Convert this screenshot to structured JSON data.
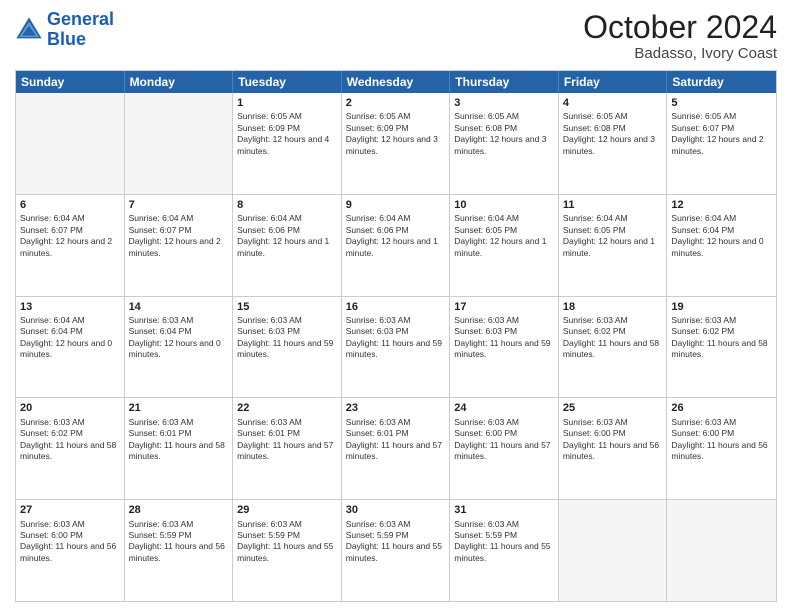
{
  "logo": {
    "line1": "General",
    "line2": "Blue"
  },
  "title": "October 2024",
  "location": "Badasso, Ivory Coast",
  "weekdays": [
    "Sunday",
    "Monday",
    "Tuesday",
    "Wednesday",
    "Thursday",
    "Friday",
    "Saturday"
  ],
  "weeks": [
    [
      {
        "day": "",
        "info": ""
      },
      {
        "day": "",
        "info": ""
      },
      {
        "day": "1",
        "info": "Sunrise: 6:05 AM\nSunset: 6:09 PM\nDaylight: 12 hours and 4 minutes."
      },
      {
        "day": "2",
        "info": "Sunrise: 6:05 AM\nSunset: 6:09 PM\nDaylight: 12 hours and 3 minutes."
      },
      {
        "day": "3",
        "info": "Sunrise: 6:05 AM\nSunset: 6:08 PM\nDaylight: 12 hours and 3 minutes."
      },
      {
        "day": "4",
        "info": "Sunrise: 6:05 AM\nSunset: 6:08 PM\nDaylight: 12 hours and 3 minutes."
      },
      {
        "day": "5",
        "info": "Sunrise: 6:05 AM\nSunset: 6:07 PM\nDaylight: 12 hours and 2 minutes."
      }
    ],
    [
      {
        "day": "6",
        "info": "Sunrise: 6:04 AM\nSunset: 6:07 PM\nDaylight: 12 hours and 2 minutes."
      },
      {
        "day": "7",
        "info": "Sunrise: 6:04 AM\nSunset: 6:07 PM\nDaylight: 12 hours and 2 minutes."
      },
      {
        "day": "8",
        "info": "Sunrise: 6:04 AM\nSunset: 6:06 PM\nDaylight: 12 hours and 1 minute."
      },
      {
        "day": "9",
        "info": "Sunrise: 6:04 AM\nSunset: 6:06 PM\nDaylight: 12 hours and 1 minute."
      },
      {
        "day": "10",
        "info": "Sunrise: 6:04 AM\nSunset: 6:05 PM\nDaylight: 12 hours and 1 minute."
      },
      {
        "day": "11",
        "info": "Sunrise: 6:04 AM\nSunset: 6:05 PM\nDaylight: 12 hours and 1 minute."
      },
      {
        "day": "12",
        "info": "Sunrise: 6:04 AM\nSunset: 6:04 PM\nDaylight: 12 hours and 0 minutes."
      }
    ],
    [
      {
        "day": "13",
        "info": "Sunrise: 6:04 AM\nSunset: 6:04 PM\nDaylight: 12 hours and 0 minutes."
      },
      {
        "day": "14",
        "info": "Sunrise: 6:03 AM\nSunset: 6:04 PM\nDaylight: 12 hours and 0 minutes."
      },
      {
        "day": "15",
        "info": "Sunrise: 6:03 AM\nSunset: 6:03 PM\nDaylight: 11 hours and 59 minutes."
      },
      {
        "day": "16",
        "info": "Sunrise: 6:03 AM\nSunset: 6:03 PM\nDaylight: 11 hours and 59 minutes."
      },
      {
        "day": "17",
        "info": "Sunrise: 6:03 AM\nSunset: 6:03 PM\nDaylight: 11 hours and 59 minutes."
      },
      {
        "day": "18",
        "info": "Sunrise: 6:03 AM\nSunset: 6:02 PM\nDaylight: 11 hours and 58 minutes."
      },
      {
        "day": "19",
        "info": "Sunrise: 6:03 AM\nSunset: 6:02 PM\nDaylight: 11 hours and 58 minutes."
      }
    ],
    [
      {
        "day": "20",
        "info": "Sunrise: 6:03 AM\nSunset: 6:02 PM\nDaylight: 11 hours and 58 minutes."
      },
      {
        "day": "21",
        "info": "Sunrise: 6:03 AM\nSunset: 6:01 PM\nDaylight: 11 hours and 58 minutes."
      },
      {
        "day": "22",
        "info": "Sunrise: 6:03 AM\nSunset: 6:01 PM\nDaylight: 11 hours and 57 minutes."
      },
      {
        "day": "23",
        "info": "Sunrise: 6:03 AM\nSunset: 6:01 PM\nDaylight: 11 hours and 57 minutes."
      },
      {
        "day": "24",
        "info": "Sunrise: 6:03 AM\nSunset: 6:00 PM\nDaylight: 11 hours and 57 minutes."
      },
      {
        "day": "25",
        "info": "Sunrise: 6:03 AM\nSunset: 6:00 PM\nDaylight: 11 hours and 56 minutes."
      },
      {
        "day": "26",
        "info": "Sunrise: 6:03 AM\nSunset: 6:00 PM\nDaylight: 11 hours and 56 minutes."
      }
    ],
    [
      {
        "day": "27",
        "info": "Sunrise: 6:03 AM\nSunset: 6:00 PM\nDaylight: 11 hours and 56 minutes."
      },
      {
        "day": "28",
        "info": "Sunrise: 6:03 AM\nSunset: 5:59 PM\nDaylight: 11 hours and 56 minutes."
      },
      {
        "day": "29",
        "info": "Sunrise: 6:03 AM\nSunset: 5:59 PM\nDaylight: 11 hours and 55 minutes."
      },
      {
        "day": "30",
        "info": "Sunrise: 6:03 AM\nSunset: 5:59 PM\nDaylight: 11 hours and 55 minutes."
      },
      {
        "day": "31",
        "info": "Sunrise: 6:03 AM\nSunset: 5:59 PM\nDaylight: 11 hours and 55 minutes."
      },
      {
        "day": "",
        "info": ""
      },
      {
        "day": "",
        "info": ""
      }
    ]
  ]
}
